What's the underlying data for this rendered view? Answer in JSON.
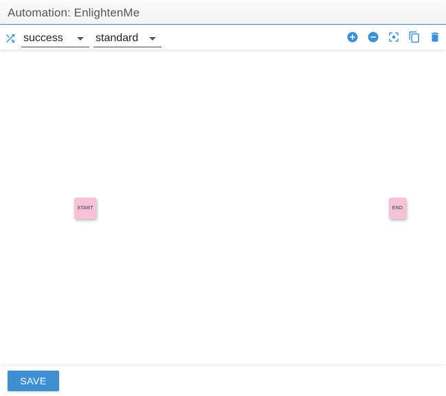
{
  "header": {
    "title": "Automation: EnlightenMe"
  },
  "toolbar": {
    "shuffle_icon": "shuffle-icon",
    "status_select": {
      "value": "success"
    },
    "type_select": {
      "value": "standard"
    },
    "actions": [
      {
        "icon": "zoom-in-icon"
      },
      {
        "icon": "zoom-out-icon"
      },
      {
        "icon": "fit-screen-icon"
      },
      {
        "icon": "copy-icon"
      },
      {
        "icon": "delete-icon"
      }
    ],
    "accent_color": "#3f8fd2"
  },
  "canvas": {
    "nodes": [
      {
        "label": "START",
        "color": "#f6c2d8"
      },
      {
        "label": "END",
        "color": "#f6c2d8"
      }
    ]
  },
  "footer": {
    "save_label": "SAVE",
    "save_color": "#3f8fd2"
  }
}
